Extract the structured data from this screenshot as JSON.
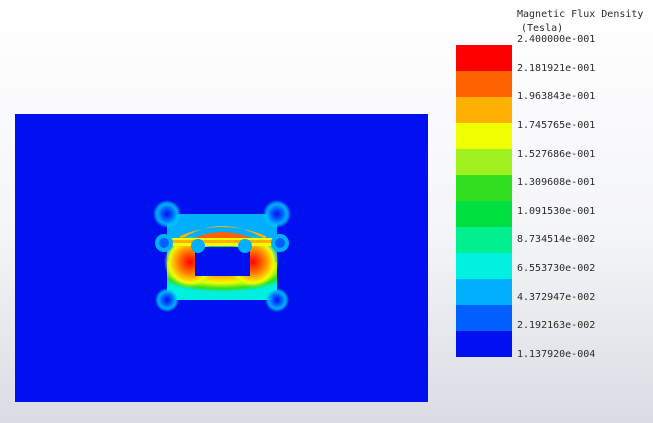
{
  "legend": {
    "title_line1": "Magnetic Flux Density",
    "title_line2": "(Tesla)",
    "ticks": [
      "2.400000e-001",
      "2.181921e-001",
      "1.963843e-001",
      "1.745765e-001",
      "1.527686e-001",
      "1.309608e-001",
      "1.091530e-001",
      "8.734514e-002",
      "6.553730e-002",
      "4.372947e-002",
      "2.192163e-002",
      "1.137920e-004"
    ],
    "colors": [
      "#ff0000",
      "#ff6000",
      "#ffb000",
      "#f0ff00",
      "#a0f020",
      "#30e020",
      "#00e040",
      "#00f090",
      "#00f0e0",
      "#00b0ff",
      "#0060ff",
      "#0010f0"
    ]
  },
  "plot": {
    "background_color": "#0010f0"
  }
}
